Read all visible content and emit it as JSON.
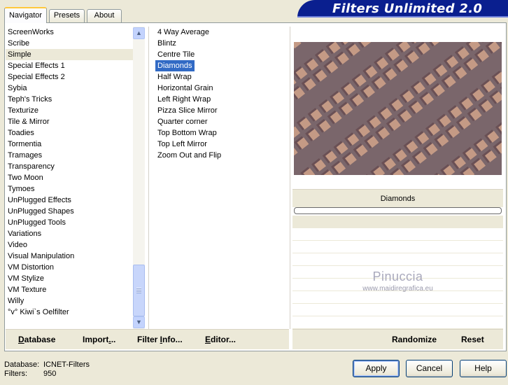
{
  "window": {
    "title": "Filters Unlimited 2.0"
  },
  "tabs": [
    {
      "label": "Navigator",
      "active": true
    },
    {
      "label": "Presets",
      "active": false
    },
    {
      "label": "About",
      "active": false
    }
  ],
  "categories": {
    "items": [
      "ScreenWorks",
      "Scribe",
      "Simple",
      "Special Effects 1",
      "Special Effects 2",
      "Sybia",
      "Teph's Tricks",
      "Texturize",
      "Tile & Mirror",
      "Toadies",
      "Tormentia",
      "Tramages",
      "Transparency",
      "Two Moon",
      "Tymoes",
      "UnPlugged Effects",
      "UnPlugged Shapes",
      "UnPlugged Tools",
      "Variations",
      "Video",
      "Visual Manipulation",
      "VM Distortion",
      "VM Stylize",
      "VM Texture",
      "Willy",
      "°v° Kiwi`s Oelfilter"
    ],
    "selected": "Simple"
  },
  "filters": {
    "items": [
      "4 Way Average",
      "Blintz",
      "Centre Tile",
      "Diamonds",
      "Half Wrap",
      "Horizontal Grain",
      "Left Right Wrap",
      "Pizza Slice Mirror",
      "Quarter corner",
      "Top Bottom Wrap",
      "Top Left Mirror",
      "Zoom Out and Flip"
    ],
    "selected": "Diamonds"
  },
  "preview": {
    "filter_name": "Diamonds",
    "progress": 0,
    "colors": {
      "stripe": "#7a666b",
      "tile_light": "#c49a85",
      "tile_shade": "#6a5055"
    }
  },
  "watermark": {
    "name": "Pinuccia",
    "url": "www.maidiregrafica.eu"
  },
  "left_buttons": {
    "database": {
      "accel": "D",
      "rest": "atabase"
    },
    "import": {
      "pre": "Import",
      "accel": ".",
      "post": ".."
    },
    "filter_info": {
      "pre": "Filter ",
      "accel": "I",
      "post": "nfo..."
    },
    "editor": {
      "accel": "E",
      "rest": "ditor..."
    }
  },
  "right_buttons": {
    "randomize": "Randomize",
    "reset": "Reset"
  },
  "info": {
    "database_label": "Database:",
    "database_value": "ICNET-Filters",
    "filters_label": "Filters:",
    "filters_value": "950"
  },
  "dialog_buttons": {
    "apply": "Apply",
    "cancel": "Cancel",
    "help": "Help"
  },
  "icons": {
    "scroll_up": "chevron-up-icon",
    "scroll_down": "chevron-down-icon"
  },
  "colors": {
    "selection": "#316ac5",
    "banner": "#0a1f8f",
    "face": "#ece9d8"
  }
}
